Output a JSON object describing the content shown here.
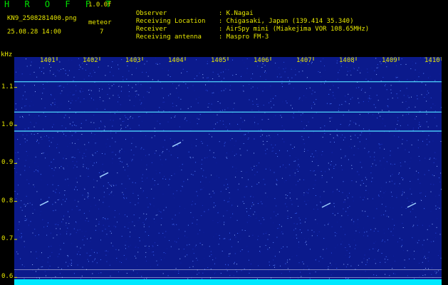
{
  "header": {
    "title": "H R O F F T",
    "version": "1.0.0f",
    "filename": "KN9_2508281400.png",
    "timestamp": "25.08.28 14:00",
    "meteor_label": "meteor",
    "meteor_count": "7"
  },
  "info": [
    {
      "label": "Observer",
      "value": ": K.Nagai"
    },
    {
      "label": "Receiving Location",
      "value": ": Chigasaki, Japan (139.414 35.340)"
    },
    {
      "label": "Receiver",
      "value": ": AirSpy mini (Miakejima VOR 108.65MHz)"
    },
    {
      "label": "Receiving antenna",
      "value": ": Maspro FM-3"
    }
  ],
  "colors": {
    "background": "#000000",
    "text": "#e8e800",
    "title": "#00e000",
    "plot_bg": "#0b1a8c",
    "signal": "#4fd8ff",
    "floor": "#00e8ff"
  },
  "chart_data": {
    "type": "heatmap",
    "ylabel": "kHz",
    "x_ticks": [
      "1401",
      "1402",
      "1403",
      "1404",
      "1405",
      "1406",
      "1407",
      "1408",
      "1409",
      "1410"
    ],
    "x_range": [
      1400,
      1410
    ],
    "y_ticks": [
      "1.1",
      "1.0",
      "0.9",
      "0.8",
      "0.7",
      "0.6"
    ],
    "y_range": [
      0.58,
      1.18
    ],
    "continuous_signals_khz": [
      1.115,
      1.035,
      0.985
    ],
    "meteor_echoes": [
      {
        "minute": 1400.7,
        "khz": 0.795
      },
      {
        "minute": 1407.3,
        "khz": 0.79
      },
      {
        "minute": 1409.3,
        "khz": 0.79
      },
      {
        "minute": 1403.8,
        "khz": 0.95
      },
      {
        "minute": 1402.1,
        "khz": 0.87
      }
    ],
    "reference_lines_khz": [
      0.62,
      0.6
    ]
  }
}
